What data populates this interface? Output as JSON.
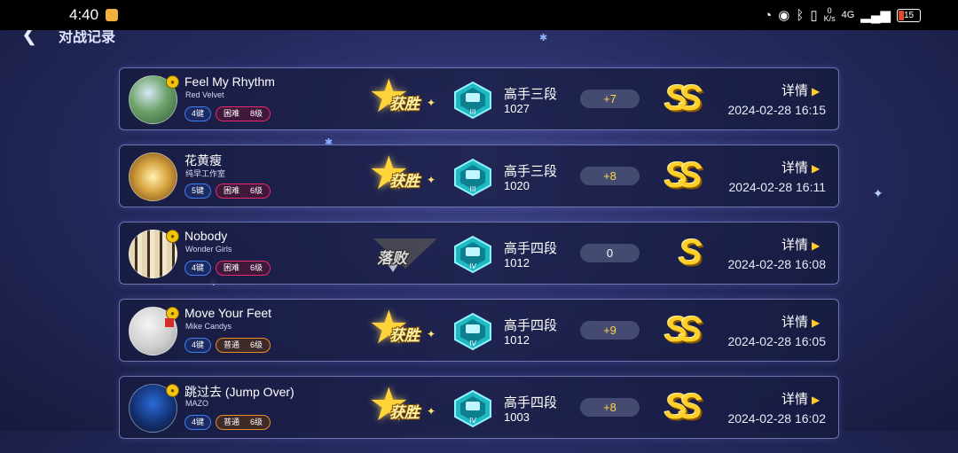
{
  "status_bar": {
    "time": "4:40",
    "net_speed_value": "0",
    "net_speed_unit": "K/s",
    "network": "4G",
    "battery": "15"
  },
  "header": {
    "back_icon": "back-arrow-icon",
    "title": "对战记录"
  },
  "detail_label": "详情",
  "records": [
    {
      "title": "Feel My Rhythm",
      "artist": "Red Velvet",
      "keys": "4键",
      "difficulty": "困难",
      "level": "8级",
      "difficulty_style": "hard",
      "result": "获胜",
      "result_type": "win",
      "rank": "高手三段",
      "rank_numeral": "III",
      "score": "1027",
      "delta": "+7",
      "grade": "SS",
      "datetime": "2024-02-28 16:15",
      "badge": "gold"
    },
    {
      "title": "花黄瘦",
      "artist": "纯早工作室",
      "keys": "5键",
      "difficulty": "困难",
      "level": "6级",
      "difficulty_style": "hard",
      "result": "获胜",
      "result_type": "win",
      "rank": "高手三段",
      "rank_numeral": "III",
      "score": "1020",
      "delta": "+8",
      "grade": "SS",
      "datetime": "2024-02-28 16:11",
      "badge": ""
    },
    {
      "title": "Nobody",
      "artist": "Wonder Girls",
      "keys": "4键",
      "difficulty": "困难",
      "level": "6级",
      "difficulty_style": "hard",
      "result": "落败",
      "result_type": "lose",
      "rank": "高手四段",
      "rank_numeral": "IV",
      "score": "1012",
      "delta": "0",
      "grade": "S",
      "datetime": "2024-02-28 16:08",
      "badge": "gold"
    },
    {
      "title": "Move Your Feet",
      "artist": "Mike Candys",
      "keys": "4键",
      "difficulty": "普通",
      "level": "6级",
      "difficulty_style": "normal",
      "result": "获胜",
      "result_type": "win",
      "rank": "高手四段",
      "rank_numeral": "IV",
      "score": "1012",
      "delta": "+9",
      "grade": "SS",
      "datetime": "2024-02-28 16:05",
      "badge": "gold-flag"
    },
    {
      "title": "跳过去 (Jump Over)",
      "artist": "MAZO",
      "keys": "4键",
      "difficulty": "普通",
      "level": "6级",
      "difficulty_style": "normal",
      "result": "获胜",
      "result_type": "win",
      "rank": "高手四段",
      "rank_numeral": "IV",
      "score": "1003",
      "delta": "+8",
      "grade": "SS",
      "datetime": "2024-02-28 16:02",
      "badge": "gold"
    }
  ]
}
